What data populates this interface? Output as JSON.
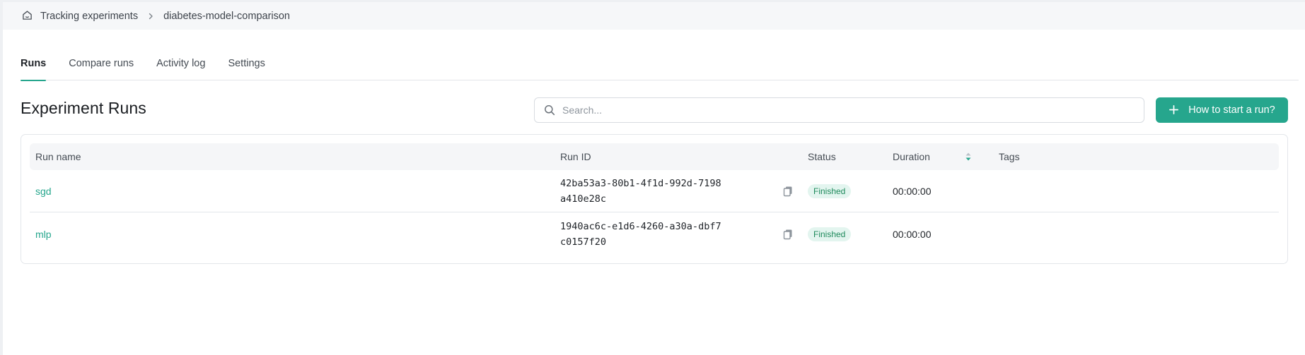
{
  "breadcrumb": {
    "home_label": "Tracking experiments",
    "current": "diabetes-model-comparison"
  },
  "tabs": [
    {
      "label": "Runs",
      "active": true
    },
    {
      "label": "Compare runs",
      "active": false
    },
    {
      "label": "Activity log",
      "active": false
    },
    {
      "label": "Settings",
      "active": false
    }
  ],
  "page": {
    "title": "Experiment Runs"
  },
  "search": {
    "placeholder": "Search...",
    "value": ""
  },
  "start_button": {
    "label": "How to start a run?"
  },
  "table": {
    "columns": {
      "run_name": "Run name",
      "run_id": "Run ID",
      "status": "Status",
      "duration": "Duration",
      "tags": "Tags"
    },
    "rows": [
      {
        "name": "sgd",
        "id": "42ba53a3-80b1-4f1d-992d-7198a410e28c",
        "status": "Finished",
        "duration": "00:00:00",
        "tags": ""
      },
      {
        "name": "mlp",
        "id": "1940ac6c-e1d6-4260-a30a-dbf7c0157f20",
        "status": "Finished",
        "duration": "00:00:00",
        "tags": ""
      }
    ]
  },
  "colors": {
    "accent": "#26a68d",
    "status_finished_bg": "#e3f5ef",
    "status_finished_text": "#1f8a5c"
  },
  "icons": {
    "home": "home-icon",
    "separator": "chevron-right-icon",
    "search": "search-icon",
    "add": "plus-icon",
    "sort": "sort-icon",
    "copy": "copy-icon"
  }
}
